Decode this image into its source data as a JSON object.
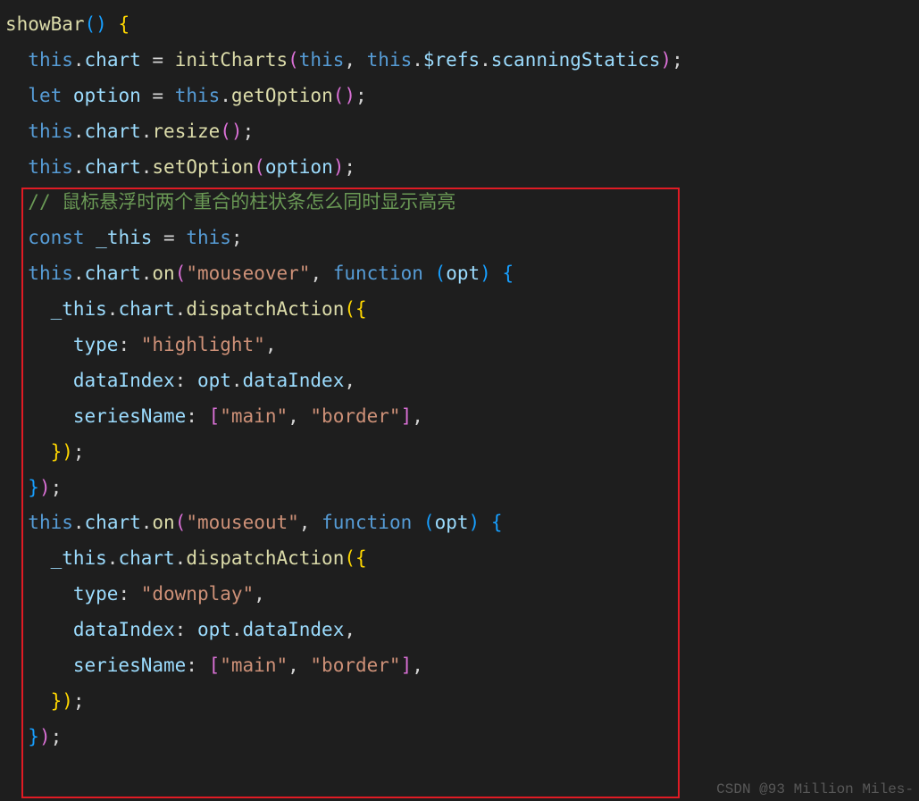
{
  "code": {
    "fn_name": "showBar",
    "line1_lhs_obj": "this",
    "line1_lhs_prop": "chart",
    "line1_op": " = ",
    "line1_call": "initCharts",
    "line1_arg_this": "this",
    "line1_arg_obj": "this",
    "line1_arg_prop1": "$refs",
    "line1_arg_prop2": "scanningStatics",
    "let_kw": "let",
    "option_var": "option",
    "eq": " = ",
    "this_kw": "this",
    "getOption": "getOption",
    "chart_prop": "chart",
    "resize": "resize",
    "setOption": "setOption",
    "option_arg": "option",
    "comment": "// 鼠标悬浮时两个重合的柱状条怎么同时显示高亮",
    "const_kw": "const",
    "uthis_var": "_this",
    "on_method": "on",
    "mouseover_str": "\"mouseover\"",
    "mouseout_str": "\"mouseout\"",
    "function_kw": "function",
    "opt_param": "opt",
    "dispatchAction": "dispatchAction",
    "type_prop": "type",
    "highlight_str": "\"highlight\"",
    "downplay_str": "\"downplay\"",
    "dataIndex_prop": "dataIndex",
    "dataIndex_val": "dataIndex",
    "seriesName_prop": "seriesName",
    "main_str": "\"main\"",
    "border_str": "\"border\""
  },
  "watermark": "CSDN @93 Million Miles-"
}
